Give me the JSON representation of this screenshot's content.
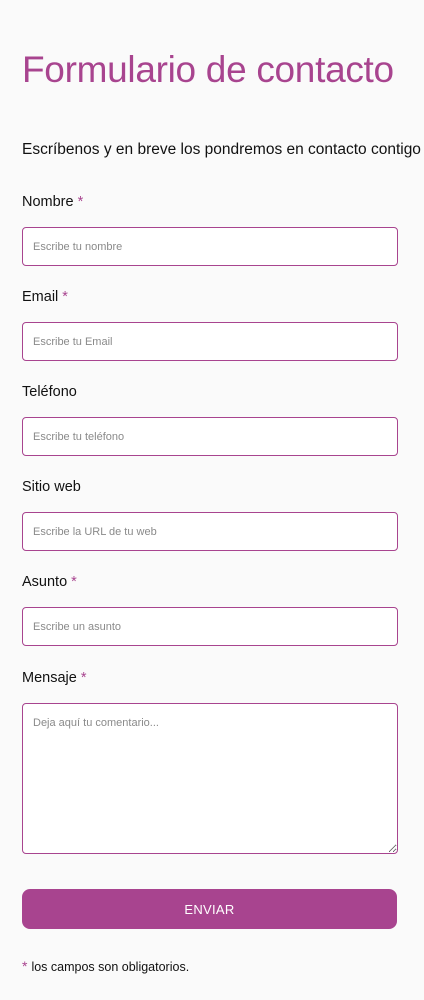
{
  "form": {
    "title": "Formulario de contacto",
    "subtitle": "Escríbenos y en breve los pondremos en contacto contigo",
    "required_marker": "*",
    "fields": [
      {
        "label": "Nombre",
        "required": true,
        "placeholder": "Escribe tu nombre",
        "value": ""
      },
      {
        "label": "Email",
        "required": true,
        "placeholder": "Escribe tu Email",
        "value": ""
      },
      {
        "label": "Teléfono",
        "required": false,
        "placeholder": "Escribe tu teléfono",
        "value": ""
      },
      {
        "label": "Sitio web",
        "required": false,
        "placeholder": "Escribe la URL de tu web",
        "value": ""
      },
      {
        "label": "Asunto",
        "required": true,
        "placeholder": "Escribe un asunto",
        "value": ""
      },
      {
        "label": "Mensaje",
        "required": true,
        "placeholder": "Deja aquí tu comentario...",
        "value": ""
      }
    ],
    "submit_label": "ENVIAR",
    "footnote": "los campos son obligatorios."
  },
  "colors": {
    "accent": "#a8448f",
    "background": "#fafafa",
    "text": "#111111",
    "placeholder": "#8a8a8a"
  }
}
